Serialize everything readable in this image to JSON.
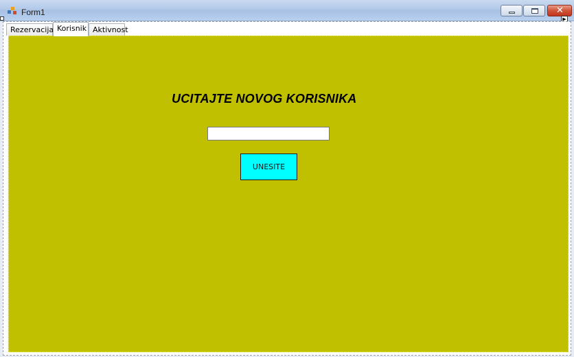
{
  "window": {
    "title": "Form1",
    "controls": {
      "minimize": "—",
      "maximize": "□",
      "close": "✕"
    }
  },
  "tabs": [
    {
      "label": "Rezervacija",
      "active": false
    },
    {
      "label": "Korisnik",
      "active": true
    },
    {
      "label": "Aktivnost",
      "active": false
    }
  ],
  "panel": {
    "background_color": "#c0c000",
    "heading": "UCITAJTE NOVOG KORISNIKA",
    "input": {
      "value": "",
      "placeholder": ""
    },
    "button": {
      "label": "UNESITE",
      "background_color": "#00ffff"
    }
  },
  "icons": {
    "app": "app-icon",
    "minimize": "minimize-icon",
    "maximize": "maximize-icon",
    "close": "close-icon"
  }
}
